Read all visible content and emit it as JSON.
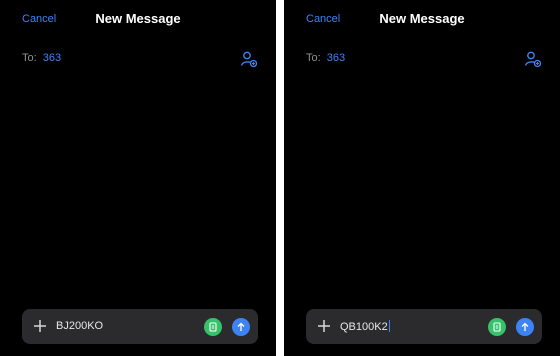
{
  "colors": {
    "accent": "#3d83f5",
    "background": "#000000",
    "composer_bg": "#2b2b2e",
    "attach_green": "#35c26a"
  },
  "screens": [
    {
      "header": {
        "cancel_label": "Cancel",
        "title": "New Message"
      },
      "recipient": {
        "label": "To:",
        "value": "363"
      },
      "composer": {
        "text": "BJ200KO"
      }
    },
    {
      "header": {
        "cancel_label": "Cancel",
        "title": "New Message"
      },
      "recipient": {
        "label": "To:",
        "value": "363"
      },
      "composer": {
        "text": "QB100K2"
      }
    }
  ]
}
